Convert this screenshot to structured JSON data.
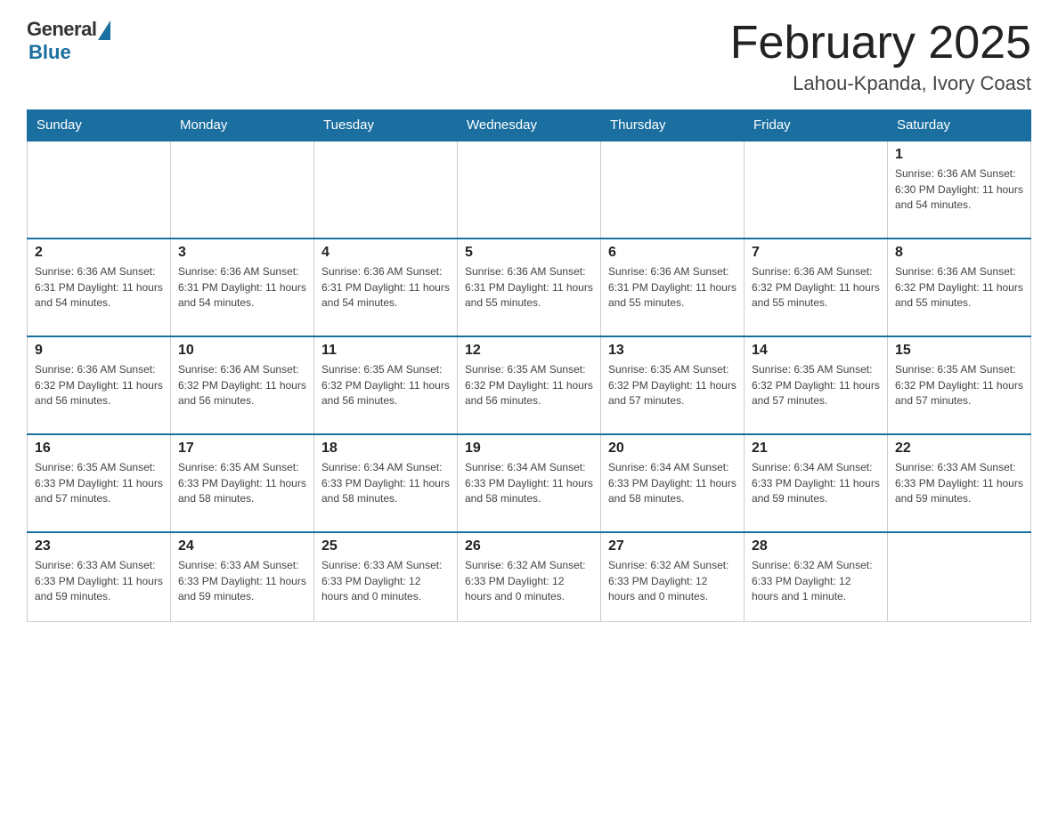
{
  "logo": {
    "general": "General",
    "blue": "Blue"
  },
  "title": "February 2025",
  "location": "Lahou-Kpanda, Ivory Coast",
  "days_of_week": [
    "Sunday",
    "Monday",
    "Tuesday",
    "Wednesday",
    "Thursday",
    "Friday",
    "Saturday"
  ],
  "weeks": [
    [
      {
        "day": "",
        "info": ""
      },
      {
        "day": "",
        "info": ""
      },
      {
        "day": "",
        "info": ""
      },
      {
        "day": "",
        "info": ""
      },
      {
        "day": "",
        "info": ""
      },
      {
        "day": "",
        "info": ""
      },
      {
        "day": "1",
        "info": "Sunrise: 6:36 AM\nSunset: 6:30 PM\nDaylight: 11 hours\nand 54 minutes."
      }
    ],
    [
      {
        "day": "2",
        "info": "Sunrise: 6:36 AM\nSunset: 6:31 PM\nDaylight: 11 hours\nand 54 minutes."
      },
      {
        "day": "3",
        "info": "Sunrise: 6:36 AM\nSunset: 6:31 PM\nDaylight: 11 hours\nand 54 minutes."
      },
      {
        "day": "4",
        "info": "Sunrise: 6:36 AM\nSunset: 6:31 PM\nDaylight: 11 hours\nand 54 minutes."
      },
      {
        "day": "5",
        "info": "Sunrise: 6:36 AM\nSunset: 6:31 PM\nDaylight: 11 hours\nand 55 minutes."
      },
      {
        "day": "6",
        "info": "Sunrise: 6:36 AM\nSunset: 6:31 PM\nDaylight: 11 hours\nand 55 minutes."
      },
      {
        "day": "7",
        "info": "Sunrise: 6:36 AM\nSunset: 6:32 PM\nDaylight: 11 hours\nand 55 minutes."
      },
      {
        "day": "8",
        "info": "Sunrise: 6:36 AM\nSunset: 6:32 PM\nDaylight: 11 hours\nand 55 minutes."
      }
    ],
    [
      {
        "day": "9",
        "info": "Sunrise: 6:36 AM\nSunset: 6:32 PM\nDaylight: 11 hours\nand 56 minutes."
      },
      {
        "day": "10",
        "info": "Sunrise: 6:36 AM\nSunset: 6:32 PM\nDaylight: 11 hours\nand 56 minutes."
      },
      {
        "day": "11",
        "info": "Sunrise: 6:35 AM\nSunset: 6:32 PM\nDaylight: 11 hours\nand 56 minutes."
      },
      {
        "day": "12",
        "info": "Sunrise: 6:35 AM\nSunset: 6:32 PM\nDaylight: 11 hours\nand 56 minutes."
      },
      {
        "day": "13",
        "info": "Sunrise: 6:35 AM\nSunset: 6:32 PM\nDaylight: 11 hours\nand 57 minutes."
      },
      {
        "day": "14",
        "info": "Sunrise: 6:35 AM\nSunset: 6:32 PM\nDaylight: 11 hours\nand 57 minutes."
      },
      {
        "day": "15",
        "info": "Sunrise: 6:35 AM\nSunset: 6:32 PM\nDaylight: 11 hours\nand 57 minutes."
      }
    ],
    [
      {
        "day": "16",
        "info": "Sunrise: 6:35 AM\nSunset: 6:33 PM\nDaylight: 11 hours\nand 57 minutes."
      },
      {
        "day": "17",
        "info": "Sunrise: 6:35 AM\nSunset: 6:33 PM\nDaylight: 11 hours\nand 58 minutes."
      },
      {
        "day": "18",
        "info": "Sunrise: 6:34 AM\nSunset: 6:33 PM\nDaylight: 11 hours\nand 58 minutes."
      },
      {
        "day": "19",
        "info": "Sunrise: 6:34 AM\nSunset: 6:33 PM\nDaylight: 11 hours\nand 58 minutes."
      },
      {
        "day": "20",
        "info": "Sunrise: 6:34 AM\nSunset: 6:33 PM\nDaylight: 11 hours\nand 58 minutes."
      },
      {
        "day": "21",
        "info": "Sunrise: 6:34 AM\nSunset: 6:33 PM\nDaylight: 11 hours\nand 59 minutes."
      },
      {
        "day": "22",
        "info": "Sunrise: 6:33 AM\nSunset: 6:33 PM\nDaylight: 11 hours\nand 59 minutes."
      }
    ],
    [
      {
        "day": "23",
        "info": "Sunrise: 6:33 AM\nSunset: 6:33 PM\nDaylight: 11 hours\nand 59 minutes."
      },
      {
        "day": "24",
        "info": "Sunrise: 6:33 AM\nSunset: 6:33 PM\nDaylight: 11 hours\nand 59 minutes."
      },
      {
        "day": "25",
        "info": "Sunrise: 6:33 AM\nSunset: 6:33 PM\nDaylight: 12 hours\nand 0 minutes."
      },
      {
        "day": "26",
        "info": "Sunrise: 6:32 AM\nSunset: 6:33 PM\nDaylight: 12 hours\nand 0 minutes."
      },
      {
        "day": "27",
        "info": "Sunrise: 6:32 AM\nSunset: 6:33 PM\nDaylight: 12 hours\nand 0 minutes."
      },
      {
        "day": "28",
        "info": "Sunrise: 6:32 AM\nSunset: 6:33 PM\nDaylight: 12 hours\nand 1 minute."
      },
      {
        "day": "",
        "info": ""
      }
    ]
  ]
}
